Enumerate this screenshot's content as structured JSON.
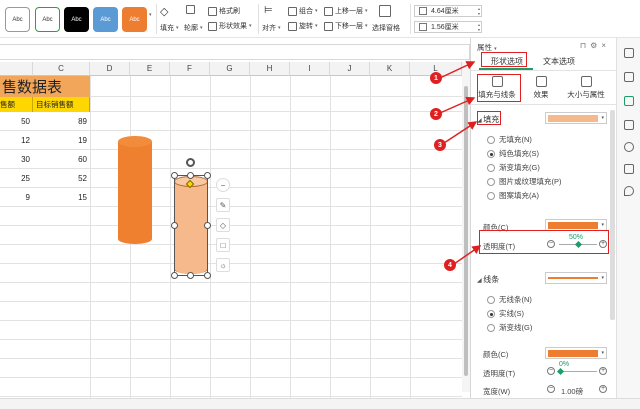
{
  "ribbon": {
    "styles": [
      "Abc",
      "Abc",
      "Abc",
      "Abc",
      "Abc"
    ],
    "style_colors": [
      "#ffffff",
      "#ffffff",
      "#000000",
      "#5b9bd5",
      "#ed7d31"
    ],
    "fill_label": "填充",
    "outline_label": "轮廓",
    "format_painter_label": "格式刷",
    "shape_effects_label": "形状效果",
    "align_label": "对齐",
    "group_label": "组合",
    "rotate_label": "旋转",
    "bring_forward_label": "上移一层",
    "send_backward_label": "下移一层",
    "selection_pane_label": "选择窗格",
    "height_value": "4.64厘米",
    "width_value": "1.56厘米"
  },
  "sheet": {
    "columns": [
      "C",
      "D",
      "E",
      "F",
      "G",
      "H",
      "I",
      "J",
      "K",
      "L"
    ],
    "title": "售数据表",
    "headers": [
      "售额",
      "目标销售额"
    ],
    "rows": [
      [
        "50",
        "89"
      ],
      [
        "12",
        "19"
      ],
      [
        "30",
        "60"
      ],
      [
        "25",
        "52"
      ],
      [
        "9",
        "15"
      ]
    ]
  },
  "panel": {
    "title": "属性",
    "tab_shape_options": "形状选项",
    "tab_text_options": "文本选项",
    "subtab_fill_line": "填充与线条",
    "subtab_effects": "效果",
    "subtab_size_props": "大小与属性",
    "fill_section": "填充",
    "fill_options": [
      "无填充(N)",
      "纯色填充(S)",
      "渐变填充(G)",
      "图片或纹理填充(P)",
      "图案填充(A)"
    ],
    "fill_selected_index": 1,
    "color_label": "颜色(C)",
    "transparency_label": "透明度(T)",
    "transparency_value": "50%",
    "transparency_fraction": 0.5,
    "line_section": "线条",
    "line_options": [
      "无线条(N)",
      "实线(S)",
      "渐变线(G)"
    ],
    "line_selected_index": 1,
    "line_color_label": "颜色(C)",
    "line_transparency_label": "透明度(T)",
    "line_transparency_value": "0%",
    "line_width_label": "宽度(W)",
    "line_width_value": "1.00磅",
    "fill_color": "#f5b98c",
    "solid_color": "#ed7d31"
  },
  "annotations": [
    "1",
    "2",
    "3",
    "4"
  ],
  "accent_color": "#e02020"
}
